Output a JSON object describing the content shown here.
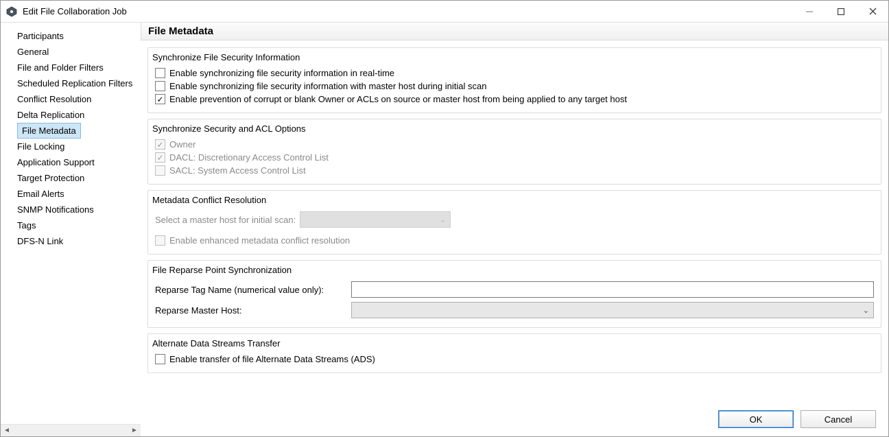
{
  "window": {
    "title": "Edit File Collaboration Job"
  },
  "sidebar": {
    "items": [
      {
        "label": "Participants"
      },
      {
        "label": "General"
      },
      {
        "label": "File and Folder Filters"
      },
      {
        "label": "Scheduled Replication Filters"
      },
      {
        "label": "Conflict Resolution"
      },
      {
        "label": "Delta Replication"
      },
      {
        "label": "File Metadata"
      },
      {
        "label": "File Locking"
      },
      {
        "label": "Application Support"
      },
      {
        "label": "Target Protection"
      },
      {
        "label": "Email Alerts"
      },
      {
        "label": "SNMP Notifications"
      },
      {
        "label": "Tags"
      },
      {
        "label": "DFS-N Link"
      }
    ],
    "selected_index": 6
  },
  "page": {
    "title": "File Metadata"
  },
  "groups": {
    "sync_sec_info": {
      "title": "Synchronize File Security Information",
      "cb_realtime": "Enable synchronizing file security information in real-time",
      "cb_initial": "Enable synchronizing file security information with master host during initial scan",
      "cb_prevent": "Enable prevention of corrupt or blank Owner or ACLs on source or master host from being applied to any target host"
    },
    "sync_acl": {
      "title": "Synchronize Security and ACL Options",
      "cb_owner": "Owner",
      "cb_dacl": "DACL: Discretionary Access Control List",
      "cb_sacl": "SACL: System Access Control List"
    },
    "meta_conflict": {
      "title": "Metadata Conflict Resolution",
      "lbl_select_master": "Select a master host for initial scan:",
      "cb_enhanced": "Enable enhanced metadata conflict resolution"
    },
    "reparse": {
      "title": "File Reparse Point Synchronization",
      "lbl_tag": "Reparse Tag Name (numerical value only):",
      "lbl_master": "Reparse Master Host:"
    },
    "ads": {
      "title": "Alternate Data Streams Transfer",
      "cb_enable": "Enable transfer of file Alternate Data Streams (ADS)"
    }
  },
  "footer": {
    "ok": "OK",
    "cancel": "Cancel"
  }
}
